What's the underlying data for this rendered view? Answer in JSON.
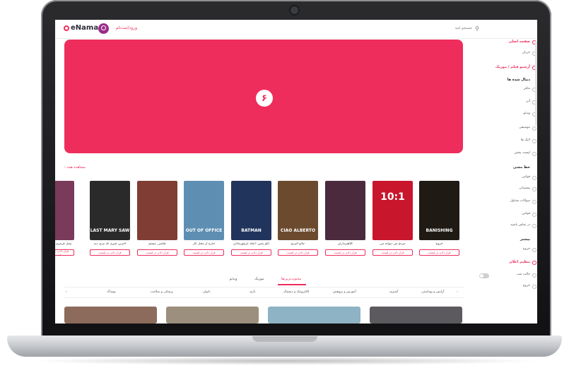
{
  "topbar": {
    "logo_text": "eNama",
    "signin_label": "ورود/ثبت‌نام",
    "search_placeholder": "جستجو کنید"
  },
  "hero": {
    "badge_text": "۶"
  },
  "section": {
    "see_all": "مشاهده همه"
  },
  "movies": [
    {
      "title": "خروج",
      "button": "قرار دادن در لیست",
      "poster_text": "BANISHING",
      "color": "#1f1a14"
    },
    {
      "title": "مردم من دیوانه من",
      "button": "قرار دادن در لیست",
      "poster_text": "10:1",
      "color": "#c8162d"
    },
    {
      "title": "کلاهبرداران",
      "button": "قرار دادن در لیست",
      "poster_text": "",
      "color": "#4b2a3e"
    },
    {
      "title": "چائو آلبرتو",
      "button": "قرار دادن در لیست",
      "poster_text": "CIAO ALBERTO",
      "color": "#6b4a2d"
    },
    {
      "title": "لگو بتمن: اتحاد ابرقهرمانان",
      "button": "قرار دادن در لیست",
      "poster_text": "BATMAN",
      "color": "#20345c"
    },
    {
      "title": "خارج از محل کار",
      "button": "قرار دادن در لیست",
      "poster_text": "OUT OF OFFICE",
      "color": "#5e8fb3"
    },
    {
      "title": "نقاشی نیستم",
      "button": "قرار دادن در لیست",
      "poster_text": "",
      "color": "#7f3d34"
    },
    {
      "title": "آخرین چیزی که مری دید",
      "button": "قرار دادن در لیست",
      "poster_text": "LAST MARY SAW",
      "color": "#2a2a2a"
    },
    {
      "title": "شنل قرمزی",
      "button": "قرار دادن در لیست",
      "poster_text": "",
      "color": "#7a3a5a"
    }
  ],
  "tabs": [
    {
      "label": "ویدئو"
    },
    {
      "label": "موزیک"
    },
    {
      "label": "محبوب‌ترین‌ها"
    }
  ],
  "categories": [
    {
      "label": "آرایش و بهداشتی"
    },
    {
      "label": "آشپزی"
    },
    {
      "label": "آموزش و پژوهش"
    },
    {
      "label": "الکترونیک و دیجیتال"
    },
    {
      "label": "بازی"
    },
    {
      "label": "بانوان"
    },
    {
      "label": "پزشکی و سلامت"
    },
    {
      "label": "پوشاک"
    }
  ],
  "thumbs": [
    {
      "color": "#8d6b5c"
    },
    {
      "color": "#9c8f7d"
    },
    {
      "color": "#8eb3c4"
    },
    {
      "color": "#5c5a5e"
    }
  ],
  "sidebar": {
    "items": [
      {
        "label": "صفحه اصلی",
        "kind": "head"
      },
      {
        "label": "جریان",
        "kind": "item"
      },
      {
        "label": "آرشیو فیلم / موزیک",
        "kind": "head"
      },
      {
        "label": "دنبال شده ها",
        "kind": "section"
      },
      {
        "label": "مایلز",
        "kind": "item"
      },
      {
        "label": "آنی",
        "kind": "item"
      },
      {
        "label": "ویدئو",
        "kind": "item"
      },
      {
        "label": "موسیقی",
        "kind": "item"
      },
      {
        "label": "لایک ها",
        "kind": "item"
      },
      {
        "label": "لیست پخش",
        "kind": "item"
      },
      {
        "label": "خط مشی",
        "kind": "section"
      },
      {
        "label": "قوانین",
        "kind": "item"
      },
      {
        "label": "پشتیبانی",
        "kind": "item"
      },
      {
        "label": "سوالات متداول",
        "kind": "item"
      },
      {
        "label": "قوانین",
        "kind": "item"
      },
      {
        "label": "در تماس باشید",
        "kind": "item"
      },
      {
        "label": "بیشتر",
        "kind": "section"
      },
      {
        "label": "خروج",
        "kind": "item"
      },
      {
        "label": "تنظیم اعلان",
        "kind": "head"
      },
      {
        "label": "حالت شب",
        "kind": "item"
      },
      {
        "label": "خروج",
        "kind": "item"
      }
    ]
  },
  "colors": {
    "accent": "#ee2d5c",
    "logo_icon": "#9b2c8a"
  }
}
